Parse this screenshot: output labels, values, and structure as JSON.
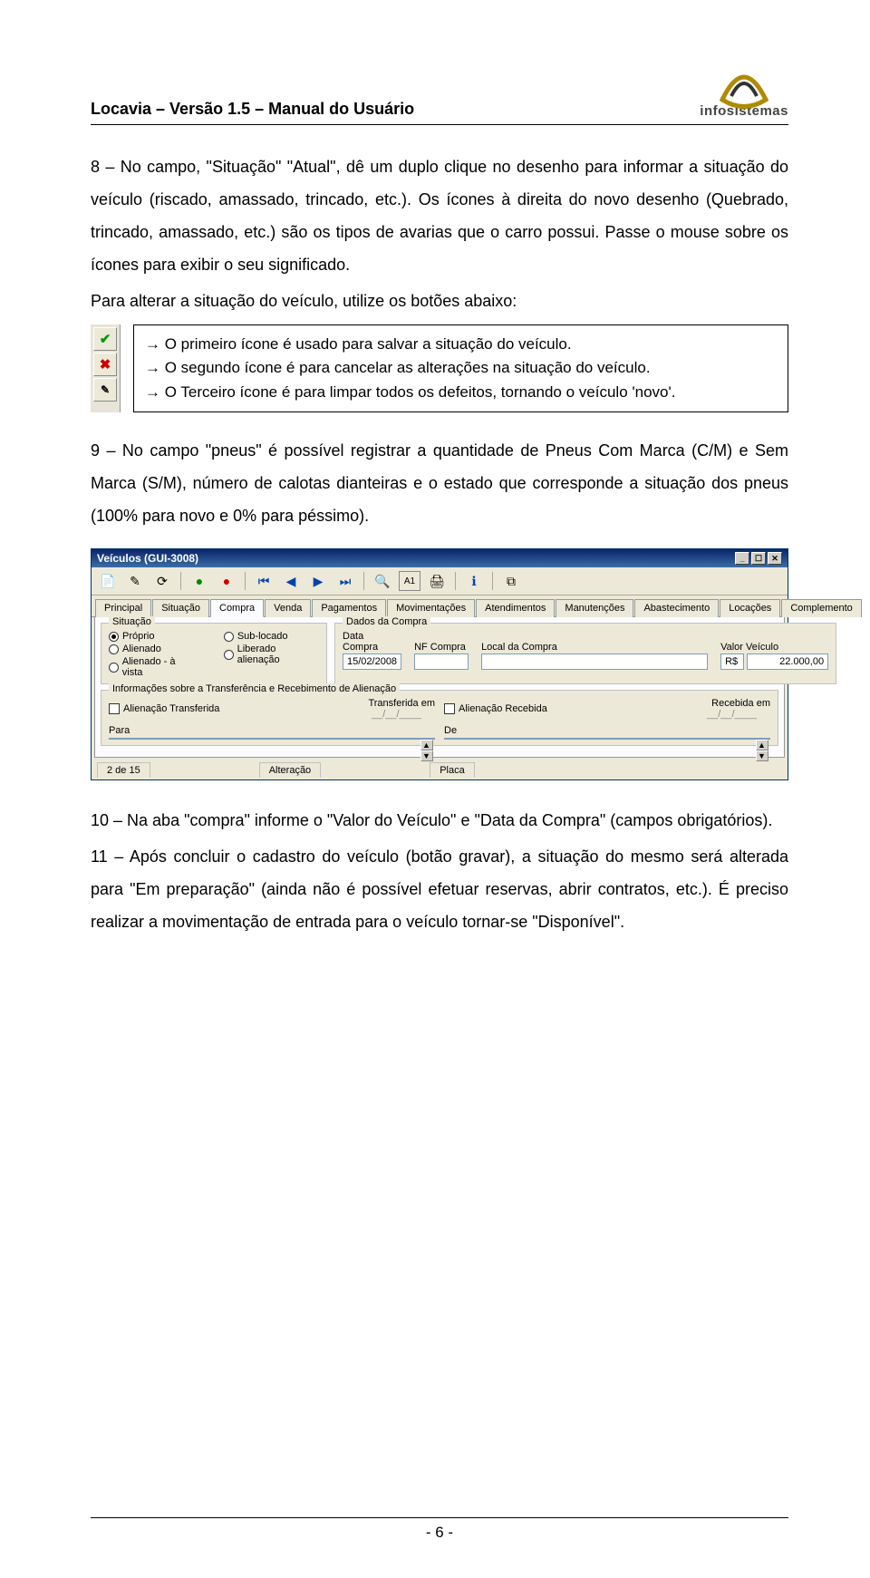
{
  "header": {
    "doc_title": "Locavia – Versão 1.5 – Manual do Usuário",
    "brand": "infosistemas"
  },
  "para8": "8 – No campo, \"Situação\" \"Atual\", dê um duplo clique no desenho para informar a situação do veículo (riscado, amassado, trincado, etc.). Os ícones à direita do novo desenho (Quebrado, trincado, amassado, etc.) são os tipos de avarias que o carro possui. Passe o mouse sobre os ícones para exibir o seu significado.",
  "para8b": "Para alterar a situação do veículo, utilize os botões abaixo:",
  "callout": {
    "line1": "→  O primeiro ícone é usado para salvar a situação do veículo.",
    "line2": "→ O segundo ícone é para cancelar as alterações na situação do veículo.",
    "line3": "→ O Terceiro ícone é para limpar todos os defeitos, tornando o veículo 'novo'."
  },
  "para9": "9 – No campo \"pneus\" é possível registrar a quantidade de Pneus Com Marca (C/M) e Sem Marca (S/M), número de calotas dianteiras e o estado que corresponde a situação dos pneus (100% para novo e 0% para péssimo).",
  "screenshot": {
    "title": "Veículos (GUI-3008)",
    "tabs": [
      "Principal",
      "Situação",
      "Compra",
      "Venda",
      "Pagamentos",
      "Movimentações",
      "Atendimentos",
      "Manutenções",
      "Abastecimento",
      "Locações",
      "Complemento"
    ],
    "active_tab": "Compra",
    "situacao_legend": "Situação",
    "radios": {
      "col1": [
        "Próprio",
        "Alienado",
        "Alienado - à vista"
      ],
      "col2": [
        "Sub-locado",
        "Liberado alienação"
      ],
      "selected": "Próprio"
    },
    "dados_legend": "Dados da Compra",
    "fields": {
      "data_compra_label": "Data Compra",
      "data_compra_value": "15/02/2008",
      "nf_label": "NF Compra",
      "nf_value": "",
      "local_label": "Local da Compra",
      "local_value": "",
      "valor_label": "Valor Veículo",
      "valor_prefix": "R$",
      "valor_value": "22.000,00"
    },
    "info_legend": "Informações sobre a Transferência e Recebimento de Alienação",
    "left": {
      "check_label": "Alienação Transferida",
      "date_label": "Transferida em",
      "date_value": "__/__/____",
      "sub_label": "Para"
    },
    "right": {
      "check_label": "Alienação Recebida",
      "date_label": "Recebida em",
      "date_value": "__/__/____",
      "sub_label": "De"
    },
    "record": {
      "count": "2 de 15",
      "alter_label": "Alteração",
      "placa_label": "Placa"
    }
  },
  "para10": "10 – Na aba \"compra\" informe o \"Valor do Veículo\" e \"Data da Compra\" (campos obrigatórios).",
  "para11": "11 – Após concluir o cadastro do veículo (botão gravar), a situação do mesmo será alterada para \"Em preparação\" (ainda não é possível efetuar reservas, abrir contratos, etc.). É preciso realizar a movimentação de entrada para o veículo tornar-se \"Disponível\".",
  "page_number": "- 6 -"
}
